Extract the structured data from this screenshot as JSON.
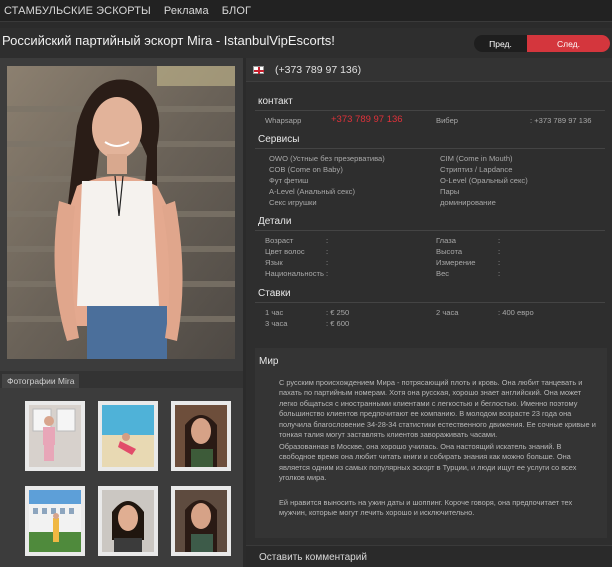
{
  "nav": {
    "items": [
      "СТАМБУЛЬСКИЕ ЭСКОРТЫ",
      "Реклама",
      "БЛОГ"
    ]
  },
  "page": {
    "title": "Российский партийный эскорт Mira - IstanbulVipEscorts!",
    "prev_label": "Пред.",
    "next_label": "След."
  },
  "phone": "(+373 789 97 136)",
  "gallery": {
    "label": "Фотографии Mira"
  },
  "contacts": {
    "heading": "контакт",
    "whatsapp_label": "Whapsapp",
    "whatsapp_value": "+373 789 97 136",
    "viber_label": "Вибер",
    "viber_value": ": +373 789 97 136"
  },
  "services": {
    "heading": "Сервисы",
    "left": [
      "OWO (Устные без презерватива)",
      "COB (Come on Baby)",
      "Фут фетиш",
      "A-Level (Анальный секс)",
      "Секс игрушки"
    ],
    "right": [
      "CIM (Come in Mouth)",
      "Стриптиз / Lapdance",
      "O-Level (Оральный секс)",
      "Пары",
      "доминирование"
    ]
  },
  "details": {
    "heading": "Детали",
    "left": [
      "Возраст",
      "Цвет волос",
      "Язык",
      "Национальность"
    ],
    "right": [
      "Глаза",
      "Высота",
      "Измерение",
      "Вес"
    ],
    "colon": ":"
  },
  "rates": {
    "heading": "Ставки",
    "r1_label": "1 час",
    "r1_value": ": € 250",
    "r2_label": "2 часа",
    "r2_value": ": 400 евро",
    "r3_label": "3 часа",
    "r3_value": ": € 600"
  },
  "about": {
    "heading": "Мир",
    "p1": "С русским происхождением Мира - потрясающий плоть и кровь. Она любит танцевать и пахать по партийным номерам. Хотя она русская, хорошо знает английский. Она может легко общаться с иностранными клиентами с легкостью и беглостью. Именно поэтому большинство клиентов предпочитают ее компанию. В молодом возрасте 23 года она получила благословение 34-28-34 статистики естественного движения. Ее сочные кривые и тонкая талия могут заставлять клиентов завораживать часами.",
    "p2": "Образованная в Москве, она хорошо училась. Она настоящий искатель знаний. В свободное время она любит читать книги и собирать знания как можно больше. Она является одним из самых популярных эскорт в Турции, и люди ищут ее услуги со всех уголков мира.",
    "p3": "Ей нравится выносить на ужин даты и шоппинг. Короче говоря, она предпочитает тех мужчин, которые могут лечить хорошо и исключительно."
  },
  "comment": {
    "heading": "Оставить комментарий"
  },
  "colors": {
    "accent": "#d4363d",
    "background": "#2b2b2b",
    "panel": "#343434"
  }
}
